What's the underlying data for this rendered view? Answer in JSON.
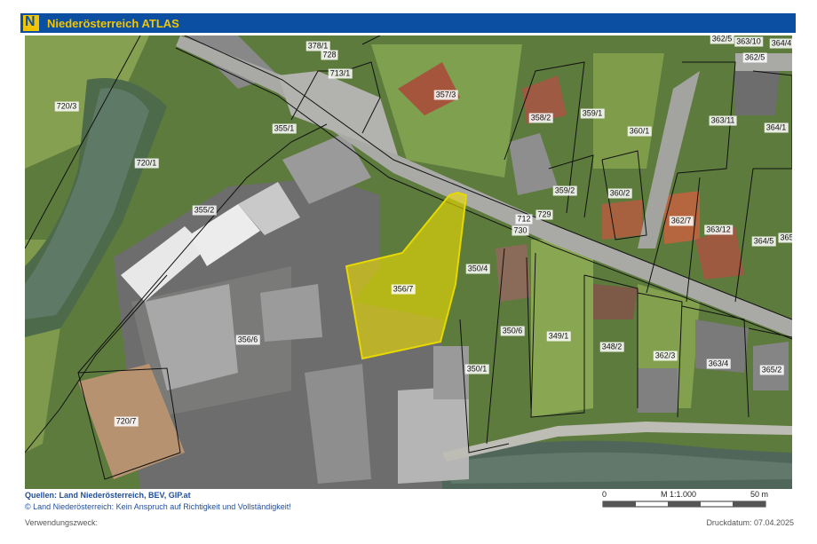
{
  "app": {
    "title": "Niederösterreich ATLAS",
    "logo_letter": "N",
    "header_color": "#0b4fa3",
    "logo_color": "#f2c500"
  },
  "map": {
    "highlight_color": "#f0e000",
    "highlighted_parcel": "356/7",
    "parcel_labels": [
      "378/1",
      "728",
      "713/1",
      "357/3",
      "362/5",
      "363/10",
      "364/4",
      "362/5",
      "720/3",
      "720/1",
      "355/1",
      "358/2",
      "359/1",
      "360/1",
      "363/11",
      "364/1",
      "355/2",
      "359/2",
      "360/2",
      "712",
      "729",
      "730",
      "362/7",
      "363/12",
      "364/5",
      "365",
      "356/7",
      "350/4",
      "350/6",
      "349/1",
      "348/2",
      "362/3",
      "363/4",
      "365/2",
      "356/6",
      "350/1",
      "720/7"
    ]
  },
  "footer": {
    "sources": "Quellen: Land Niederösterreich, BEV, GIP.at",
    "copyright": "© Land Niederösterreich: Kein Anspruch auf Richtigkeit und Vollständigkeit!",
    "scale_start": "0",
    "scale_ratio": "M 1:1.000",
    "scale_end": "50 m",
    "purpose_label": "Verwendungszweck:",
    "print_date": "Druckdatum: 07.04.2025"
  }
}
